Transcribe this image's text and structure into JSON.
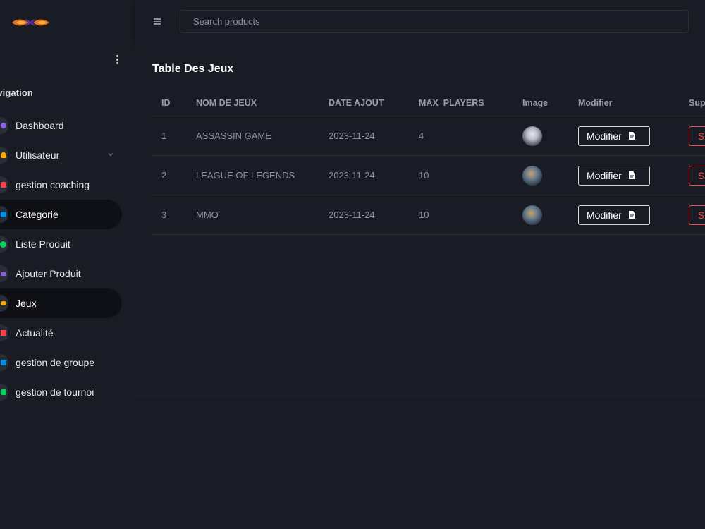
{
  "search": {
    "placeholder": "Search products"
  },
  "sidebar": {
    "category": "avigation",
    "items": [
      {
        "label": "Dashboard",
        "icon": "speedometer-icon",
        "color": "#8f5fe8"
      },
      {
        "label": "Utilisateur",
        "icon": "users-icon",
        "color": "#ffab00"
      },
      {
        "label": "gestion coaching",
        "icon": "chart-icon",
        "color": "#fc424a"
      },
      {
        "label": "Categorie",
        "icon": "folder-icon",
        "color": "#0090e7"
      },
      {
        "label": "Liste Produit",
        "icon": "dot-icon",
        "color": "#00d25b"
      },
      {
        "label": "Ajouter Produit",
        "icon": "list-icon",
        "color": "#8f5fe8"
      },
      {
        "label": "Jeux",
        "icon": "gamepad-icon",
        "color": "#ffab00"
      },
      {
        "label": "Actualité",
        "icon": "news-icon",
        "color": "#fc424a"
      },
      {
        "label": "gestion de groupe",
        "icon": "chart-icon",
        "color": "#0090e7"
      },
      {
        "label": "gestion de tournoi",
        "icon": "chart-icon",
        "color": "#00d25b"
      }
    ],
    "active": [
      "Categorie",
      "Jeux"
    ]
  },
  "main": {
    "title": "Table Des Jeux",
    "columns": [
      "ID",
      "NOM DE JEUX",
      "DATE AJOUT",
      "MAX_PLAYERS",
      "Image",
      "Modifier",
      "Sup"
    ],
    "rows": [
      {
        "id": "1",
        "nom": "ASSASSIN GAME",
        "date": "2023-11-24",
        "max": "4",
        "image": "avatar-light",
        "modifier": "Modifier",
        "sup": "Su"
      },
      {
        "id": "2",
        "nom": "LEAGUE OF LEGENDS",
        "date": "2023-11-24",
        "max": "10",
        "image": "avatar-dark",
        "modifier": "Modifier",
        "sup": "Su"
      },
      {
        "id": "3",
        "nom": "MMO",
        "date": "2023-11-24",
        "max": "10",
        "image": "avatar-dark",
        "modifier": "Modifier",
        "sup": "Su"
      }
    ]
  },
  "colors": {
    "background": "#191c24",
    "active_item": "#0f1015",
    "danger": "#fc424a",
    "muted_text": "#8c8fa3"
  }
}
